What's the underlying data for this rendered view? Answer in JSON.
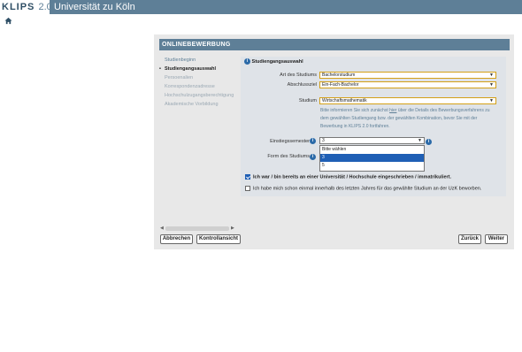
{
  "topbar": {
    "logo": "KLIPS",
    "logo_version": "2.0",
    "university": "Universität zu Köln"
  },
  "nav_icon": "home-icon",
  "header": {
    "title": "ONLINEBEWERBUNG"
  },
  "sidebar": {
    "items": [
      {
        "label": "Studienbeginn"
      },
      {
        "label": "Studiengangsauswahl"
      },
      {
        "label": "Persoenalien"
      },
      {
        "label": "Korrespondenzadresse"
      },
      {
        "label": "Hochschulzugangsberechtigung"
      },
      {
        "label": "Akademische Vorbildung"
      }
    ]
  },
  "panel": {
    "title": "Studiengangsauswahl",
    "art_label": "Art des Studiums",
    "art_value": "Bachelorstudium",
    "abschluss_label": "Abschlussziel",
    "abschluss_value": "Ein-Fach-Bachelor",
    "studium_label": "Studium",
    "studium_value": "Wirtschaftsmathematik",
    "info_prefix": "Bitte informieren Sie sich zunächst ",
    "info_link": "hier",
    "info_suffix": " über die Details des Bewerbungsverfahrens zu dem gewählten Studiengang bzw. der gewählten Kombination, bevor Sie mit der Bewerbung in KLIPS 2.0 fortfahren.",
    "semester_label": "Einstiegssemester",
    "semester_value": "3",
    "semester_options": [
      "Bitte wählen",
      "3",
      "5"
    ],
    "form_label": "Form des Studiums",
    "check1_label": "Ich war / bin bereits an einer Universität / Hochschule eingeschrieben / immatrikuliert.",
    "check2_label": "Ich habe mich schon einmal innerhalb des letzten Jahres für das gewählte Studium an der UzK beworben."
  },
  "buttons": {
    "abbrechen": "Abbrechen",
    "kontrollansicht": "Kontrollansicht",
    "zurueck": "Zurück",
    "weiter": "Weiter"
  },
  "colors": {
    "brand": "#5e7f97",
    "field_border": "#d4a017",
    "highlight": "#1f5fb5"
  }
}
